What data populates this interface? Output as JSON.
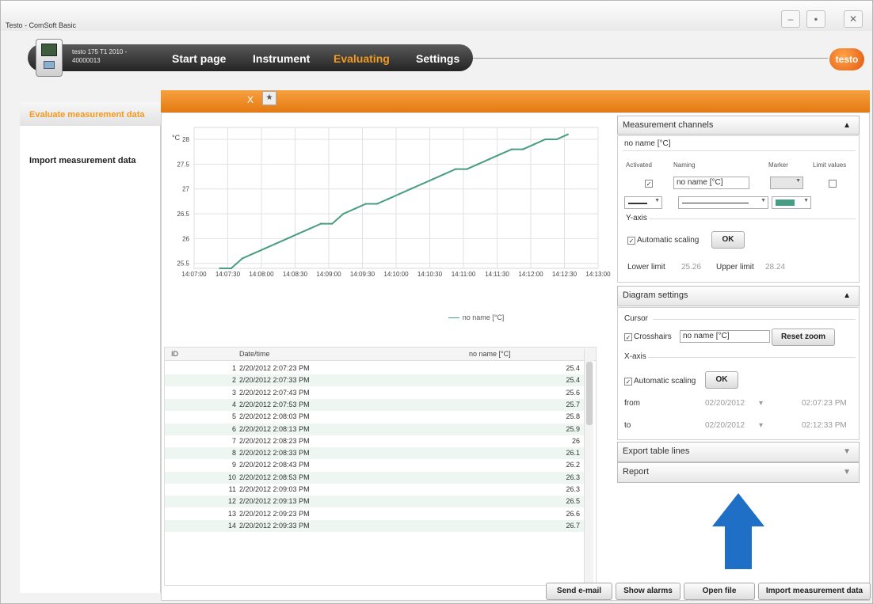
{
  "window": {
    "title": "Testo - ComSoft Basic",
    "controls": {
      "minimize": "–",
      "maximize": "▪",
      "close": "✕"
    }
  },
  "nav": {
    "device_line1": "testo 175 T1 2010 -",
    "device_line2": "40000013",
    "items": [
      "Start page",
      "Instrument",
      "Evaluating",
      "Settings"
    ],
    "active": "Evaluating",
    "logo": "testo"
  },
  "sidebar": {
    "items": [
      {
        "label": "Evaluate measurement data",
        "active": true
      },
      {
        "label": "Import measurement data",
        "active": false
      }
    ]
  },
  "tabs": {
    "close_glyph": "X",
    "new_glyph": "★"
  },
  "chart_data": {
    "type": "line",
    "yunit": "°C",
    "x": [
      "14:07:00",
      "14:07:30",
      "14:08:00",
      "14:08:30",
      "14:09:00",
      "14:09:30",
      "14:10:00",
      "14:10:30",
      "14:11:00",
      "14:11:30",
      "14:12:00",
      "14:12:30",
      "14:13:00"
    ],
    "ytick_labels": [
      "25.5",
      "26",
      "26.5",
      "27",
      "27.5",
      "28"
    ],
    "ylim": [
      25.4,
      28.24
    ],
    "series": [
      {
        "name": "no name [°C]",
        "color": "#4a9d85",
        "points": [
          [
            "14:07:23",
            25.4
          ],
          [
            "14:07:33",
            25.4
          ],
          [
            "14:07:43",
            25.6
          ],
          [
            "14:07:53",
            25.7
          ],
          [
            "14:08:03",
            25.8
          ],
          [
            "14:08:13",
            25.9
          ],
          [
            "14:08:23",
            26.0
          ],
          [
            "14:08:33",
            26.1
          ],
          [
            "14:08:43",
            26.2
          ],
          [
            "14:08:53",
            26.3
          ],
          [
            "14:09:03",
            26.3
          ],
          [
            "14:09:13",
            26.5
          ],
          [
            "14:09:23",
            26.6
          ],
          [
            "14:09:33",
            26.7
          ],
          [
            "14:09:43",
            26.7
          ],
          [
            "14:09:53",
            26.8
          ],
          [
            "14:10:03",
            26.9
          ],
          [
            "14:10:13",
            27.0
          ],
          [
            "14:10:23",
            27.1
          ],
          [
            "14:10:33",
            27.2
          ],
          [
            "14:10:43",
            27.3
          ],
          [
            "14:10:53",
            27.4
          ],
          [
            "14:11:03",
            27.4
          ],
          [
            "14:11:13",
            27.5
          ],
          [
            "14:11:23",
            27.6
          ],
          [
            "14:11:33",
            27.7
          ],
          [
            "14:11:43",
            27.8
          ],
          [
            "14:11:53",
            27.8
          ],
          [
            "14:12:03",
            27.9
          ],
          [
            "14:12:13",
            28.0
          ],
          [
            "14:12:23",
            28.0
          ],
          [
            "14:12:33",
            28.1
          ]
        ]
      }
    ],
    "legend": "no name [°C]",
    "grid": true
  },
  "table": {
    "headers": [
      "ID",
      "Date/time",
      "no name [°C]"
    ],
    "rows": [
      [
        "1",
        "2/20/2012 2:07:23 PM",
        "25.4"
      ],
      [
        "2",
        "2/20/2012 2:07:33 PM",
        "25.4"
      ],
      [
        "3",
        "2/20/2012 2:07:43 PM",
        "25.6"
      ],
      [
        "4",
        "2/20/2012 2:07:53 PM",
        "25.7"
      ],
      [
        "5",
        "2/20/2012 2:08:03 PM",
        "25.8"
      ],
      [
        "6",
        "2/20/2012 2:08:13 PM",
        "25.9"
      ],
      [
        "7",
        "2/20/2012 2:08:23 PM",
        "26"
      ],
      [
        "8",
        "2/20/2012 2:08:33 PM",
        "26.1"
      ],
      [
        "9",
        "2/20/2012 2:08:43 PM",
        "26.2"
      ],
      [
        "10",
        "2/20/2012 2:08:53 PM",
        "26.3"
      ],
      [
        "11",
        "2/20/2012 2:09:03 PM",
        "26.3"
      ],
      [
        "12",
        "2/20/2012 2:09:13 PM",
        "26.5"
      ],
      [
        "13",
        "2/20/2012 2:09:23 PM",
        "26.6"
      ],
      [
        "14",
        "2/20/2012 2:09:33 PM",
        "26.7"
      ]
    ]
  },
  "buttons": {
    "send_email": "Send e-mail",
    "show_alarms": "Show alarms",
    "open_file": "Open file",
    "import": "Import measurement data"
  },
  "measurement_panel": {
    "title": "Measurement channels",
    "channel": "no name [°C]",
    "col_activated": "Activated",
    "col_naming": "Naming",
    "col_marker": "Marker",
    "col_limit": "Limit values",
    "activated_checked": true,
    "naming_value": "no name [°C]",
    "line_color": "#4a9d85",
    "yaxis_label": "Y-axis",
    "auto_scaling": "Automatic scaling",
    "auto_scaling_checked": true,
    "ok": "OK",
    "lower_limit_label": "Lower limit",
    "lower_limit_value": "25.26",
    "upper_limit_label": "Upper limit",
    "upper_limit_value": "28.24"
  },
  "diagram_panel": {
    "title": "Diagram settings",
    "cursor_label": "Cursor",
    "crosshairs": "Crosshairs",
    "crosshairs_checked": true,
    "cursor_channel": "no name [°C]",
    "reset_zoom": "Reset zoom",
    "xaxis_label": "X-axis",
    "auto_scaling": "Automatic scaling",
    "auto_scaling_checked": true,
    "ok": "OK",
    "from_label": "from",
    "from_date": "02/20/2012",
    "from_time": "02:07:23 PM",
    "to_label": "to",
    "to_date": "02/20/2012",
    "to_time": "02:12:33 PM"
  },
  "collapsed_panels": {
    "export": "Export table lines",
    "report": "Report"
  },
  "colors": {
    "accent": "#f39a21",
    "arrow": "#1f6fc6"
  }
}
